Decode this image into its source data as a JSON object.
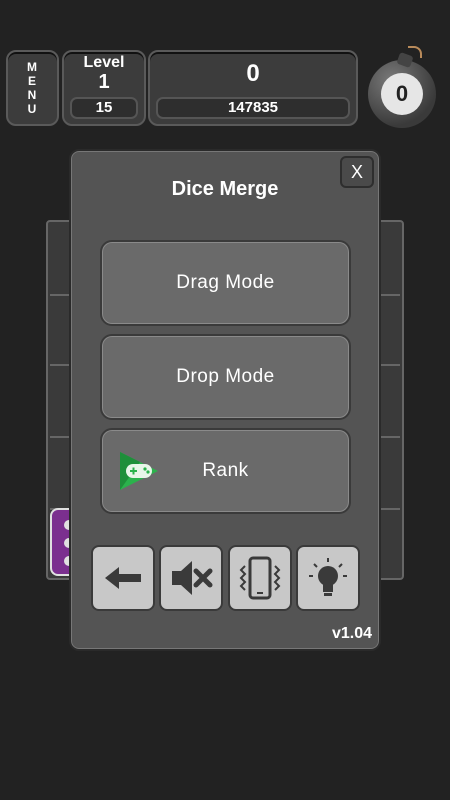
{
  "hud": {
    "menu_letters": [
      "M",
      "E",
      "N",
      "U"
    ],
    "level_label": "Level",
    "level_value": "1",
    "level_sub": "15",
    "score": "0",
    "best_score": "147835",
    "bomb_count": "0"
  },
  "dialog": {
    "title": "Dice Merge",
    "close_label": "X",
    "drag_mode": "Drag Mode",
    "drop_mode": "Drop Mode",
    "rank": "Rank",
    "version": "v1.04"
  },
  "icons": {
    "back": "arrow-left-icon",
    "sound": "speaker-muted-icon",
    "vibrate": "phone-vibrate-icon",
    "hint": "lightbulb-icon",
    "rank": "game-controller-icon"
  },
  "colors": {
    "background": "#222222",
    "dialog": "#545454",
    "button": "#6a6a6a",
    "tool_button": "#c8c8c8",
    "tile_purple": "#7b2f8f",
    "rank_green": "#2bb24c"
  }
}
